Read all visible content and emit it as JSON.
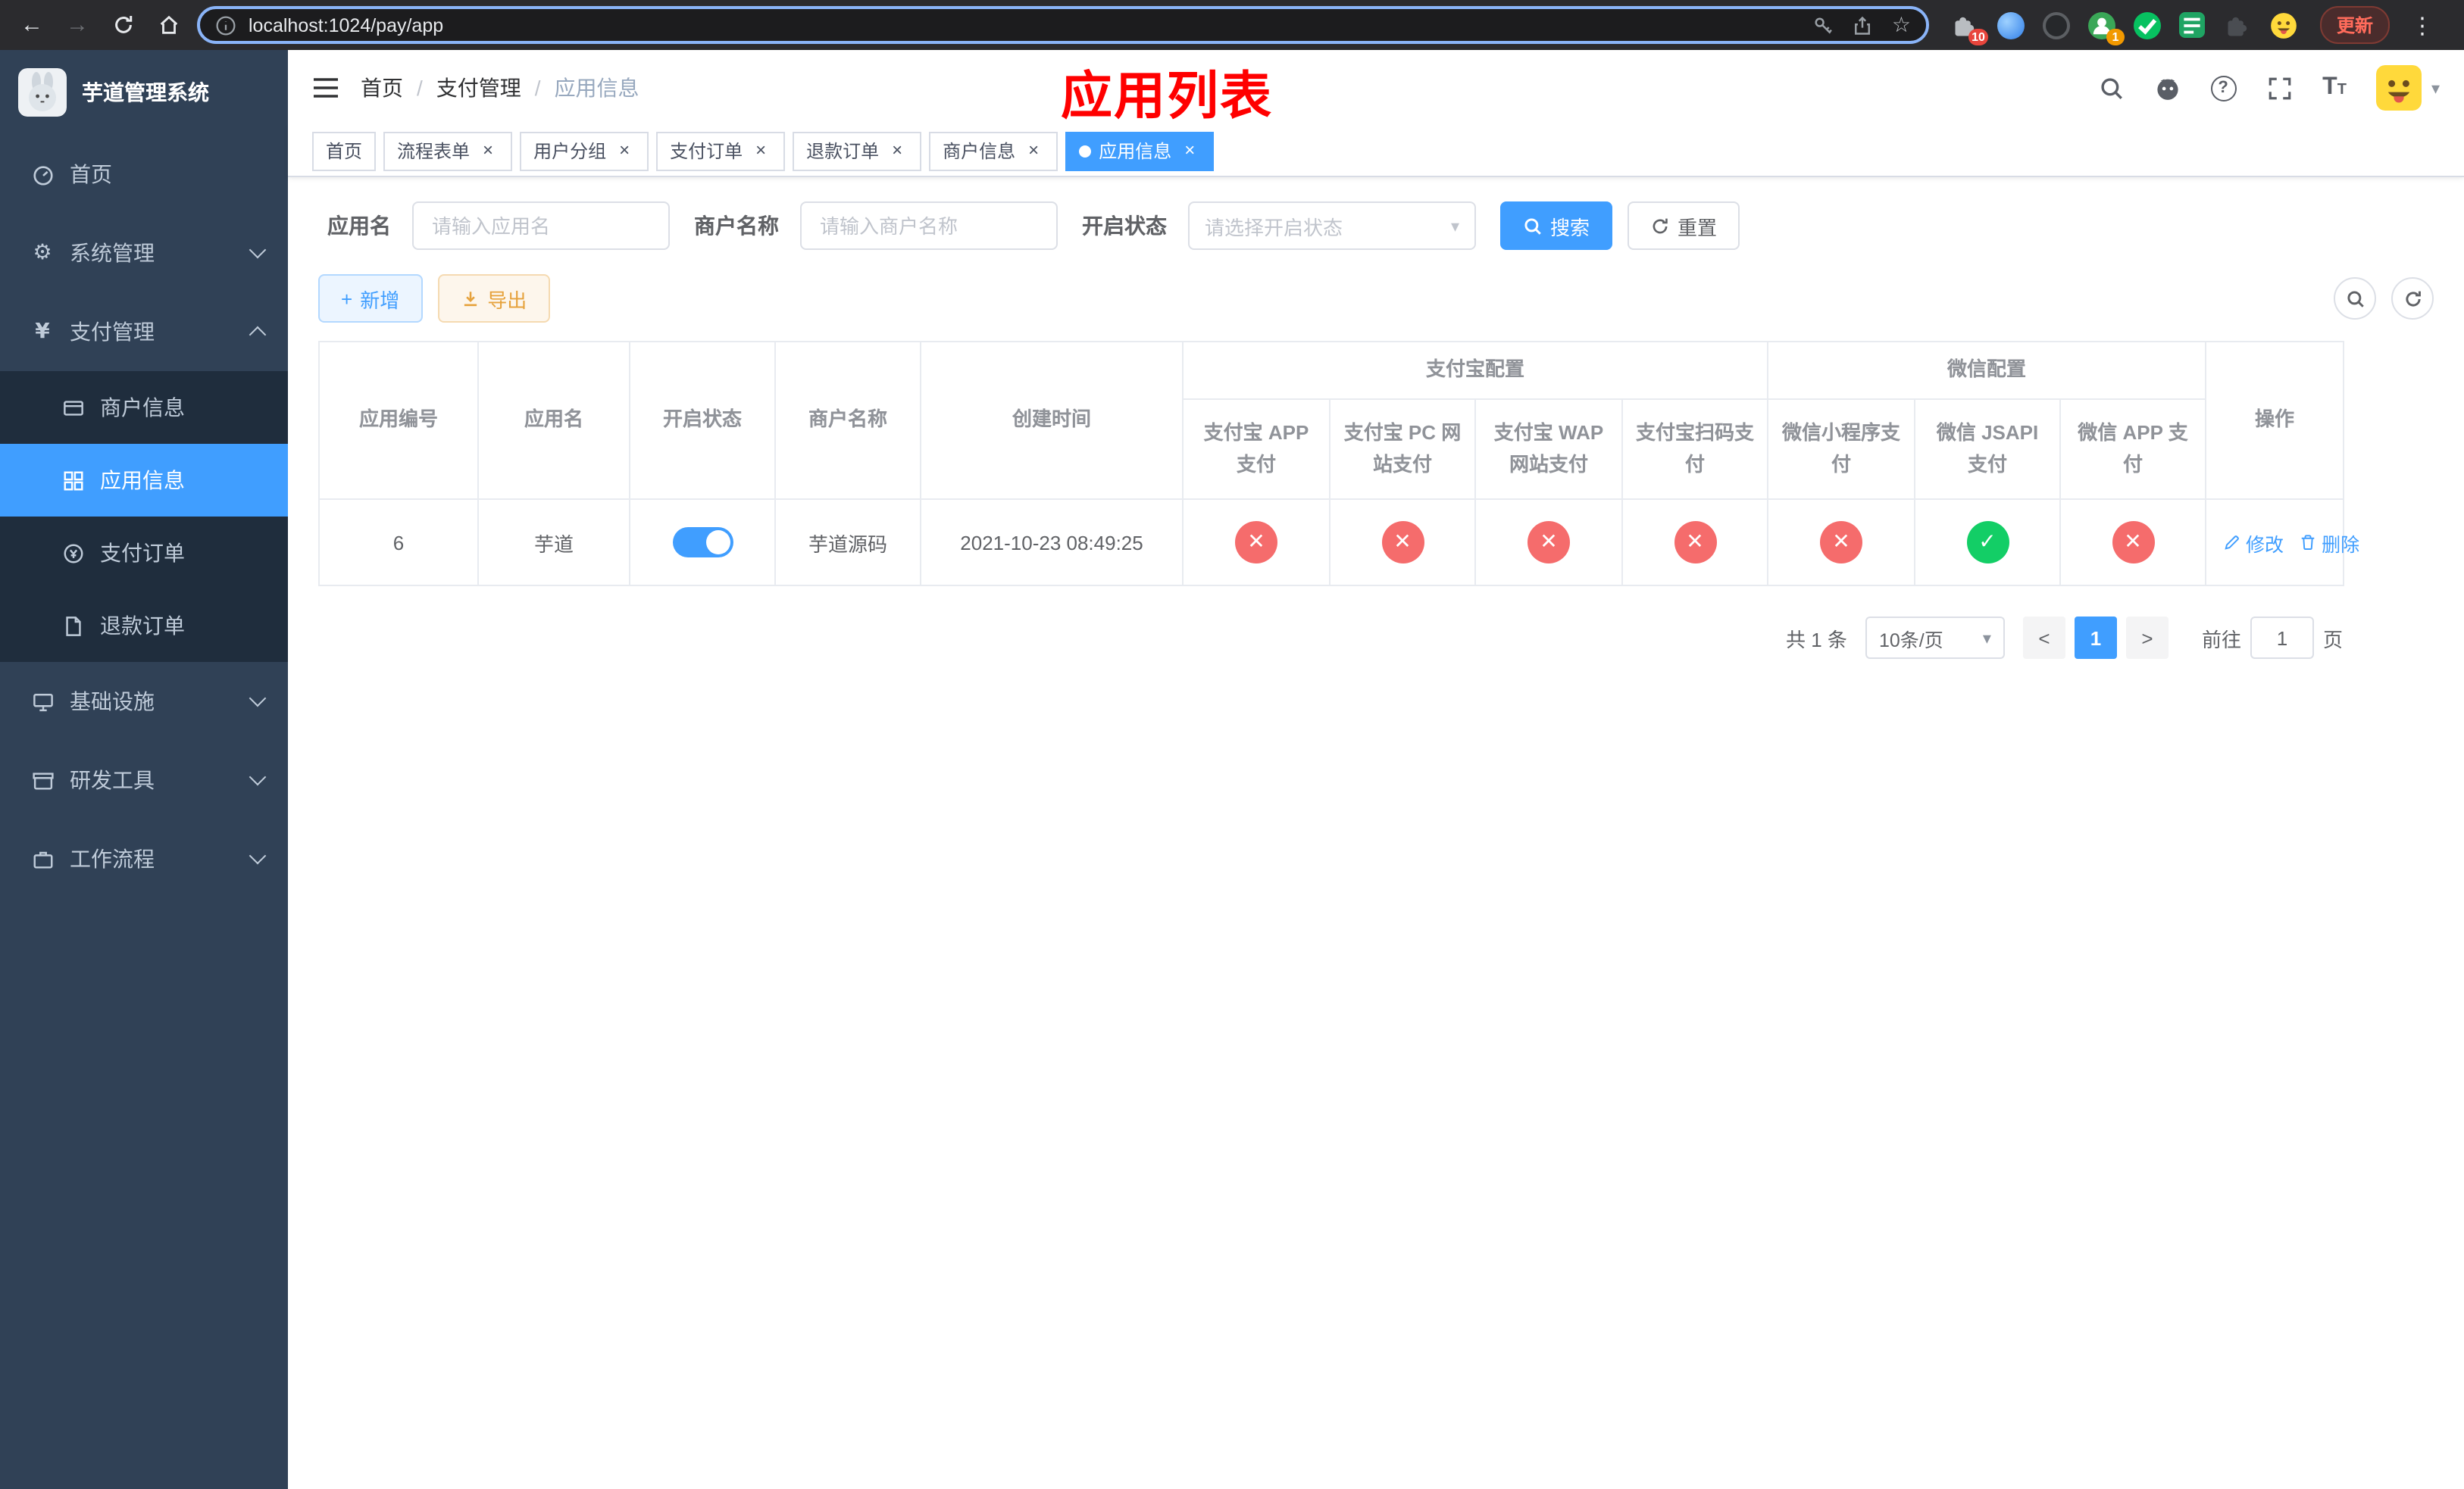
{
  "colors": {
    "primary": "#409eff",
    "danger": "#f56c6c",
    "success": "#13ce66",
    "warning": "#e6a23c",
    "annotation_red": "#ff0000",
    "sidebar_bg": "#304156",
    "submenu_bg": "#1f2d3d"
  },
  "icons": {
    "back": "←",
    "forward": "→",
    "star": "☆",
    "menu_dots": "⋮",
    "caret_down": "▾",
    "question": "?",
    "text_size_large": "T",
    "text_size_small": "T",
    "yen": "¥",
    "gear": "⚙",
    "plus": "+",
    "close": "✕",
    "check": "✓",
    "tab_close": "×",
    "prev": "<",
    "next": ">"
  },
  "annotation": {
    "text": "应用列表"
  },
  "browser": {
    "url": "localhost:1024/pay/app",
    "update_button": "更新",
    "extensions_badge": "10",
    "profile_badge": "1"
  },
  "sidebar": {
    "title": "芋道管理系统",
    "menu": [
      {
        "label": "首页"
      },
      {
        "label": "系统管理"
      },
      {
        "label": "支付管理"
      },
      {
        "label": "基础设施"
      },
      {
        "label": "研发工具"
      },
      {
        "label": "工作流程"
      }
    ],
    "payment_children": [
      {
        "label": "商户信息"
      },
      {
        "label": "应用信息"
      },
      {
        "label": "支付订单"
      },
      {
        "label": "退款订单"
      }
    ]
  },
  "breadcrumb": {
    "items": [
      "首页",
      "支付管理",
      "应用信息"
    ],
    "separator": "/"
  },
  "tabs": [
    {
      "label": "首页"
    },
    {
      "label": "流程表单"
    },
    {
      "label": "用户分组"
    },
    {
      "label": "支付订单"
    },
    {
      "label": "退款订单"
    },
    {
      "label": "商户信息"
    },
    {
      "label": "应用信息"
    }
  ],
  "filters": {
    "app_name": {
      "label": "应用名",
      "placeholder": "请输入应用名",
      "value": ""
    },
    "merchant_name": {
      "label": "商户名称",
      "placeholder": "请输入商户名称",
      "value": ""
    },
    "status": {
      "label": "开启状态",
      "placeholder": "请选择开启状态"
    },
    "search": "搜索",
    "reset": "重置"
  },
  "toolbar": {
    "add": "新增",
    "export": "导出"
  },
  "table": {
    "headers": {
      "app_id": "应用编号",
      "app_name": "应用名",
      "status": "开启状态",
      "merchant_name": "商户名称",
      "created_at": "创建时间",
      "alipay_group": "支付宝配置",
      "wechat_group": "微信配置",
      "alipay_app": "支付宝 APP 支付",
      "alipay_pc": "支付宝 PC 网站支付",
      "alipay_wap": "支付宝 WAP 网站支付",
      "alipay_qr": "支付宝扫码支付",
      "wechat_lite": "微信小程序支付",
      "wechat_jsapi": "微信 JSAPI 支付",
      "wechat_app": "微信 APP 支付",
      "actions": "操作"
    },
    "rows": [
      {
        "app_id": "6",
        "app_name": "芋道",
        "enabled": true,
        "merchant_name": "芋道源码",
        "created_at": "2021-10-23 08:49:25",
        "configs": {
          "alipay_app": false,
          "alipay_pc": false,
          "alipay_wap": false,
          "alipay_qr": false,
          "wechat_lite": false,
          "wechat_jsapi": true,
          "wechat_app": false
        },
        "actions": {
          "edit": "修改",
          "delete": "删除"
        }
      }
    ]
  },
  "pagination": {
    "total": "共 1 条",
    "page_size": "10条/页",
    "page": "1",
    "goto_label": "前往",
    "goto_value": "1",
    "page_unit": "页"
  }
}
